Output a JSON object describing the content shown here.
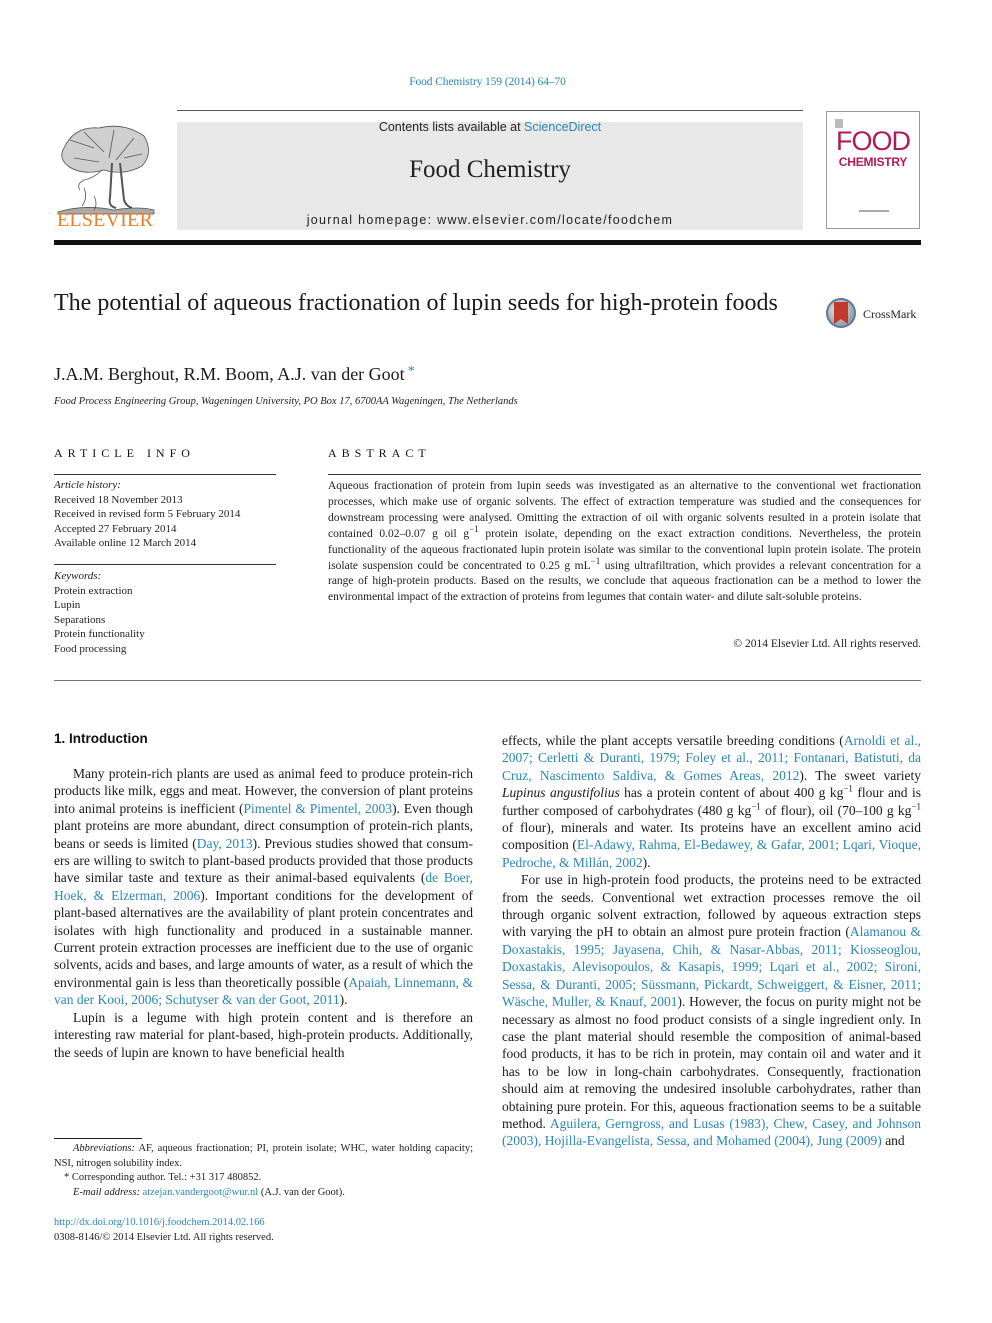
{
  "header": {
    "citation": "Food Chemistry 159 (2014) 64–70",
    "contents_prefix": "Contents lists available at ",
    "contents_link": "ScienceDirect",
    "journal_name": "Food Chemistry",
    "homepage": "journal homepage: www.elsevier.com/locate/foodchem",
    "publisher_logo_text": "ELSEVIER",
    "cover_line1": "FOOD",
    "cover_line2": "CHEMISTRY",
    "colors": {
      "link": "#2a87b3",
      "elsevier_orange": "#f07d1e",
      "cover_magenta": "#b11a5a"
    }
  },
  "article": {
    "title": "The potential of aqueous fractionation of lupin seeds for high-protein foods",
    "crossmark_label": "CrossMark",
    "authors": "J.A.M. Berghout, R.M. Boom, A.J. van der Goot",
    "corresponding_mark": "*",
    "affiliation": "Food Process Engineering Group, Wageningen University, PO Box 17, 6700AA Wageningen, The Netherlands"
  },
  "article_info": {
    "heading": "ARTICLE INFO",
    "history_label": "Article history:",
    "history": [
      "Received 18 November 2013",
      "Received in revised form 5 February 2014",
      "Accepted 27 February 2014",
      "Available online 12 March 2014"
    ],
    "keywords_label": "Keywords:",
    "keywords": [
      "Protein extraction",
      "Lupin",
      "Separations",
      "Protein functionality",
      "Food processing"
    ]
  },
  "abstract": {
    "heading": "ABSTRACT",
    "text_part1": "Aqueous fractionation of protein from lupin seeds was investigated as an alternative to the conventional wet fractionation processes, which make use of organic solvents. The effect of extraction temperature was studied and the consequences for downstream processing were analysed. Omitting the extraction of oil with organic solvents resulted in a protein isolate that contained 0.02–0.07 g oil g",
    "sup1": "−1",
    "text_part2": " protein isolate, depending on the exact extraction conditions. Nevertheless, the protein functionality of the aqueous fractionated lupin protein isolate was similar to the conventional lupin protein isolate. The protein isolate suspension could be concentrated to 0.25 g mL",
    "sup2": "−1",
    "text_part3": " using ultrafiltration, which provides a relevant concentration for a range of high-protein products. Based on the results, we conclude that aqueous fractionation can be a method to lower the environmental impact of the extraction of proteins from legumes that contain water- and dilute salt-soluble proteins.",
    "copyright": "© 2014 Elsevier Ltd. All rights reserved."
  },
  "body": {
    "intro_heading": "1. Introduction",
    "left": {
      "p1": [
        {
          "t": "Many protein-rich plants are used as animal feed to produce protein-rich products like milk, eggs and meat. However, the conversion of plant proteins into animal proteins is inefficient ("
        },
        {
          "t": "Pimentel & Pimentel, 2003",
          "link": true
        },
        {
          "t": "). Even though plant proteins are more abundant, direct consumption of protein-rich plants, beans or seeds is limited ("
        },
        {
          "t": "Day, 2013",
          "link": true
        },
        {
          "t": "). Previous studies showed that consum­ers are willing to switch to plant-based products provided that those products have similar taste and texture as their animal-based equivalents ("
        },
        {
          "t": "de Boer, Hoek, & Elzerman, 2006",
          "link": true
        },
        {
          "t": "). Important conditions for the development of plant-based alternatives are the availability of plant protein concentrates and isolates with high functionality and produced in a sustainable manner. Current pro­tein extraction processes are inefficient due to the use of organic solvents, acids and bases, and large amounts of water, as a result of which the environmental gain is less than theoretically possible ("
        },
        {
          "t": "Apaiah, Linnemann, & van der Kooi, 2006; Schutyser & van der Goot, 2011",
          "link": true
        },
        {
          "t": ")."
        }
      ],
      "p2": [
        {
          "t": "Lupin is a legume with high protein content and is therefore an interesting raw material for plant-based, high-protein products. Additionally, the seeds of lupin are known to have beneficial health"
        }
      ]
    },
    "right": {
      "p1": [
        {
          "t": "effects, while the plant accepts versatile breeding conditions ("
        },
        {
          "t": "Arnoldi et al., 2007; Cerletti & Duranti, 1979; Foley et al., 2011; Fontanari, Batistuti, da Cruz, Nascimento Saldiva, & Gomes Areas, 2012",
          "link": true
        },
        {
          "t": "). The sweet variety "
        },
        {
          "t": "Lupinus angustifolius",
          "italic": true
        },
        {
          "t": " has a protein content of about 400 g kg"
        },
        {
          "t": "−1",
          "sup": true
        },
        {
          "t": " flour and is further composed of carbohydrates (480 g kg"
        },
        {
          "t": "−1",
          "sup": true
        },
        {
          "t": " of flour), oil (70–100 g kg"
        },
        {
          "t": "−1",
          "sup": true
        },
        {
          "t": " of flour), minerals and water. Its proteins have an excellent amino acid composition ("
        },
        {
          "t": "El-Adawy, Rahma, El-Bedawey, & Gafar, 2001; Lqari, Vioque, Pedroche, & Millán, 2002",
          "link": true
        },
        {
          "t": ")."
        }
      ],
      "p2": [
        {
          "t": "For use in high-protein food products, the proteins need to be extracted from the seeds. Conventional wet extraction processes re­move the oil through organic solvent extraction, followed by aque­ous extraction steps with varying the pH to obtain an almost pure protein fraction ("
        },
        {
          "t": "Alamanou & Doxastakis, 1995; Jayasena, Chih, & Nasar-Abbas, 2011; Kiosseoglou, Doxastakis, Alevisopoulos, & Kasapis, 1999; Lqari et al., 2002; Sironi, Sessa, & Duranti, 2005; Süssmann, Pickardt, Schweiggert, & Eisner, 2011; Wäsche, Muller, & Knauf, 2001",
          "link": true
        },
        {
          "t": "). However, the focus on purity might not be neces­sary as almost no food product consists of a single ingredient only. In case the plant material should resemble the composition of ani­mal-based food products, it has to be rich in protein, may contain oil and water and it has to be low in long-chain carbohydrates. Consequently, fractionation should aim at removing the undesired insoluble carbohydrates, rather than obtaining pure protein. For this, aqueous fractionation seems to be a suitable method. "
        },
        {
          "t": "Aguilera, Gerngross, and Lusas (1983), Chew, Casey, and Johnson (2003), Hojilla-Evangelista, Sessa, and Mohamed (2004), Jung (2009)",
          "link": true
        },
        {
          "t": " and"
        }
      ]
    }
  },
  "footnotes": {
    "abbrev_label": "Abbreviations:",
    "abbrev_text": " AF, aqueous fractionation; PI, protein isolate; WHC, water holding capacity; NSI, nitrogen solubility index.",
    "corresponding": "* Corresponding author. Tel.: +31 317 480852.",
    "email_label": "E-mail address:",
    "email": "atzejan.vandergoot@wur.nl",
    "email_suffix": " (A.J. van der Goot).",
    "doi": "http://dx.doi.org/10.1016/j.foodchem.2014.02.166",
    "issn_copyright": "0308-8146/© 2014 Elsevier Ltd. All rights reserved."
  }
}
